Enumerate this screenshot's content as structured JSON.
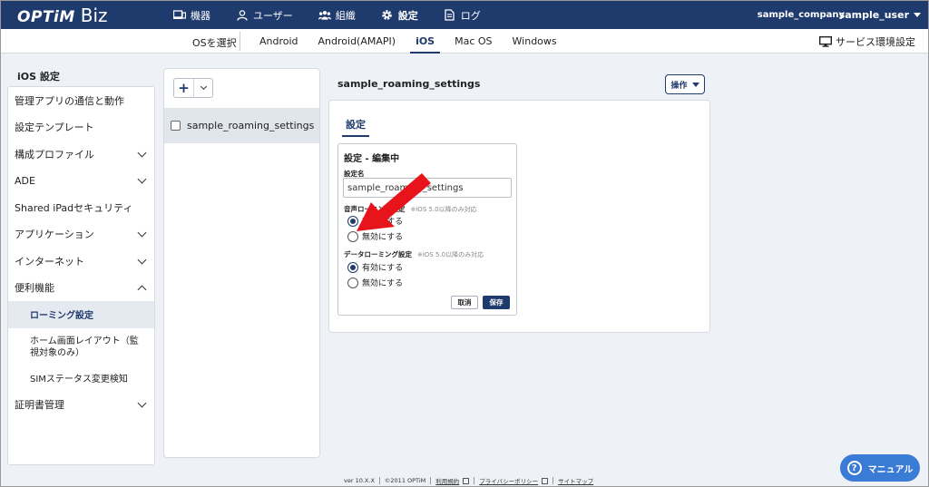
{
  "brand": {
    "logo_main": "OPTiM",
    "logo_sub": "Biz"
  },
  "nav": {
    "items": [
      {
        "label": "機器",
        "icon": "device-icon"
      },
      {
        "label": "ユーザー",
        "icon": "user-icon"
      },
      {
        "label": "組織",
        "icon": "group-icon"
      },
      {
        "label": "設定",
        "icon": "gear-icon",
        "active": true
      },
      {
        "label": "ログ",
        "icon": "log-icon"
      }
    ],
    "company": "sample_company",
    "user": "sample_user"
  },
  "osbar": {
    "select_label": "OSを選択",
    "tabs": [
      "Android",
      "Android(AMAPI)",
      "iOS",
      "Mac OS",
      "Windows"
    ],
    "active_tab": "iOS",
    "service_label": "サービス環境設定"
  },
  "sidebar": {
    "title": "iOS 設定",
    "items": [
      {
        "label": "管理アプリの通信と動作"
      },
      {
        "label": "設定テンプレート"
      },
      {
        "label": "構成プロファイル",
        "expand": "down"
      },
      {
        "label": "ADE",
        "expand": "down"
      },
      {
        "label": "Shared iPadセキュリティ"
      },
      {
        "label": "アプリケーション",
        "expand": "down"
      },
      {
        "label": "インターネット",
        "expand": "down"
      },
      {
        "label": "便利機能",
        "expand": "up"
      },
      {
        "label": "ローミング設定",
        "sub": true,
        "active": true
      },
      {
        "label": "ホーム画面レイアウト（監視対象のみ）",
        "sub": true
      },
      {
        "label": "SIMステータス変更検知",
        "sub": true
      },
      {
        "label": "証明書管理",
        "expand": "down"
      }
    ]
  },
  "list": {
    "add_label": "+",
    "items": [
      {
        "label": "sample_roaming_settings"
      }
    ]
  },
  "content": {
    "title": "sample_roaming_settings",
    "operation_label": "操作",
    "tab_label": "設定",
    "edit": {
      "title": "設定 - 編集中",
      "name_label": "設定名",
      "name_value": "sample_roaming_settings",
      "voice_label": "音声ローミング設定",
      "voice_note": "※iOS 5.0以降のみ対応",
      "voice_on": "有効にする",
      "voice_off": "無効にする",
      "data_label": "データローミング設定",
      "data_note": "※iOS 5.0以降のみ対応",
      "data_on": "有効にする",
      "data_off": "無効にする",
      "cancel": "取消",
      "save": "保存"
    }
  },
  "footer": {
    "version": "ver 10.X.X",
    "copyright": "©2011 OPTiM",
    "terms": "利用規約",
    "privacy": "プライバシーポリシー",
    "sitemap": "サイトマップ"
  },
  "manual": {
    "label": "マニュアル"
  },
  "colors": {
    "primary": "#1f3b6e",
    "manual": "#3a7bd5",
    "arrow": "#e8141b"
  }
}
